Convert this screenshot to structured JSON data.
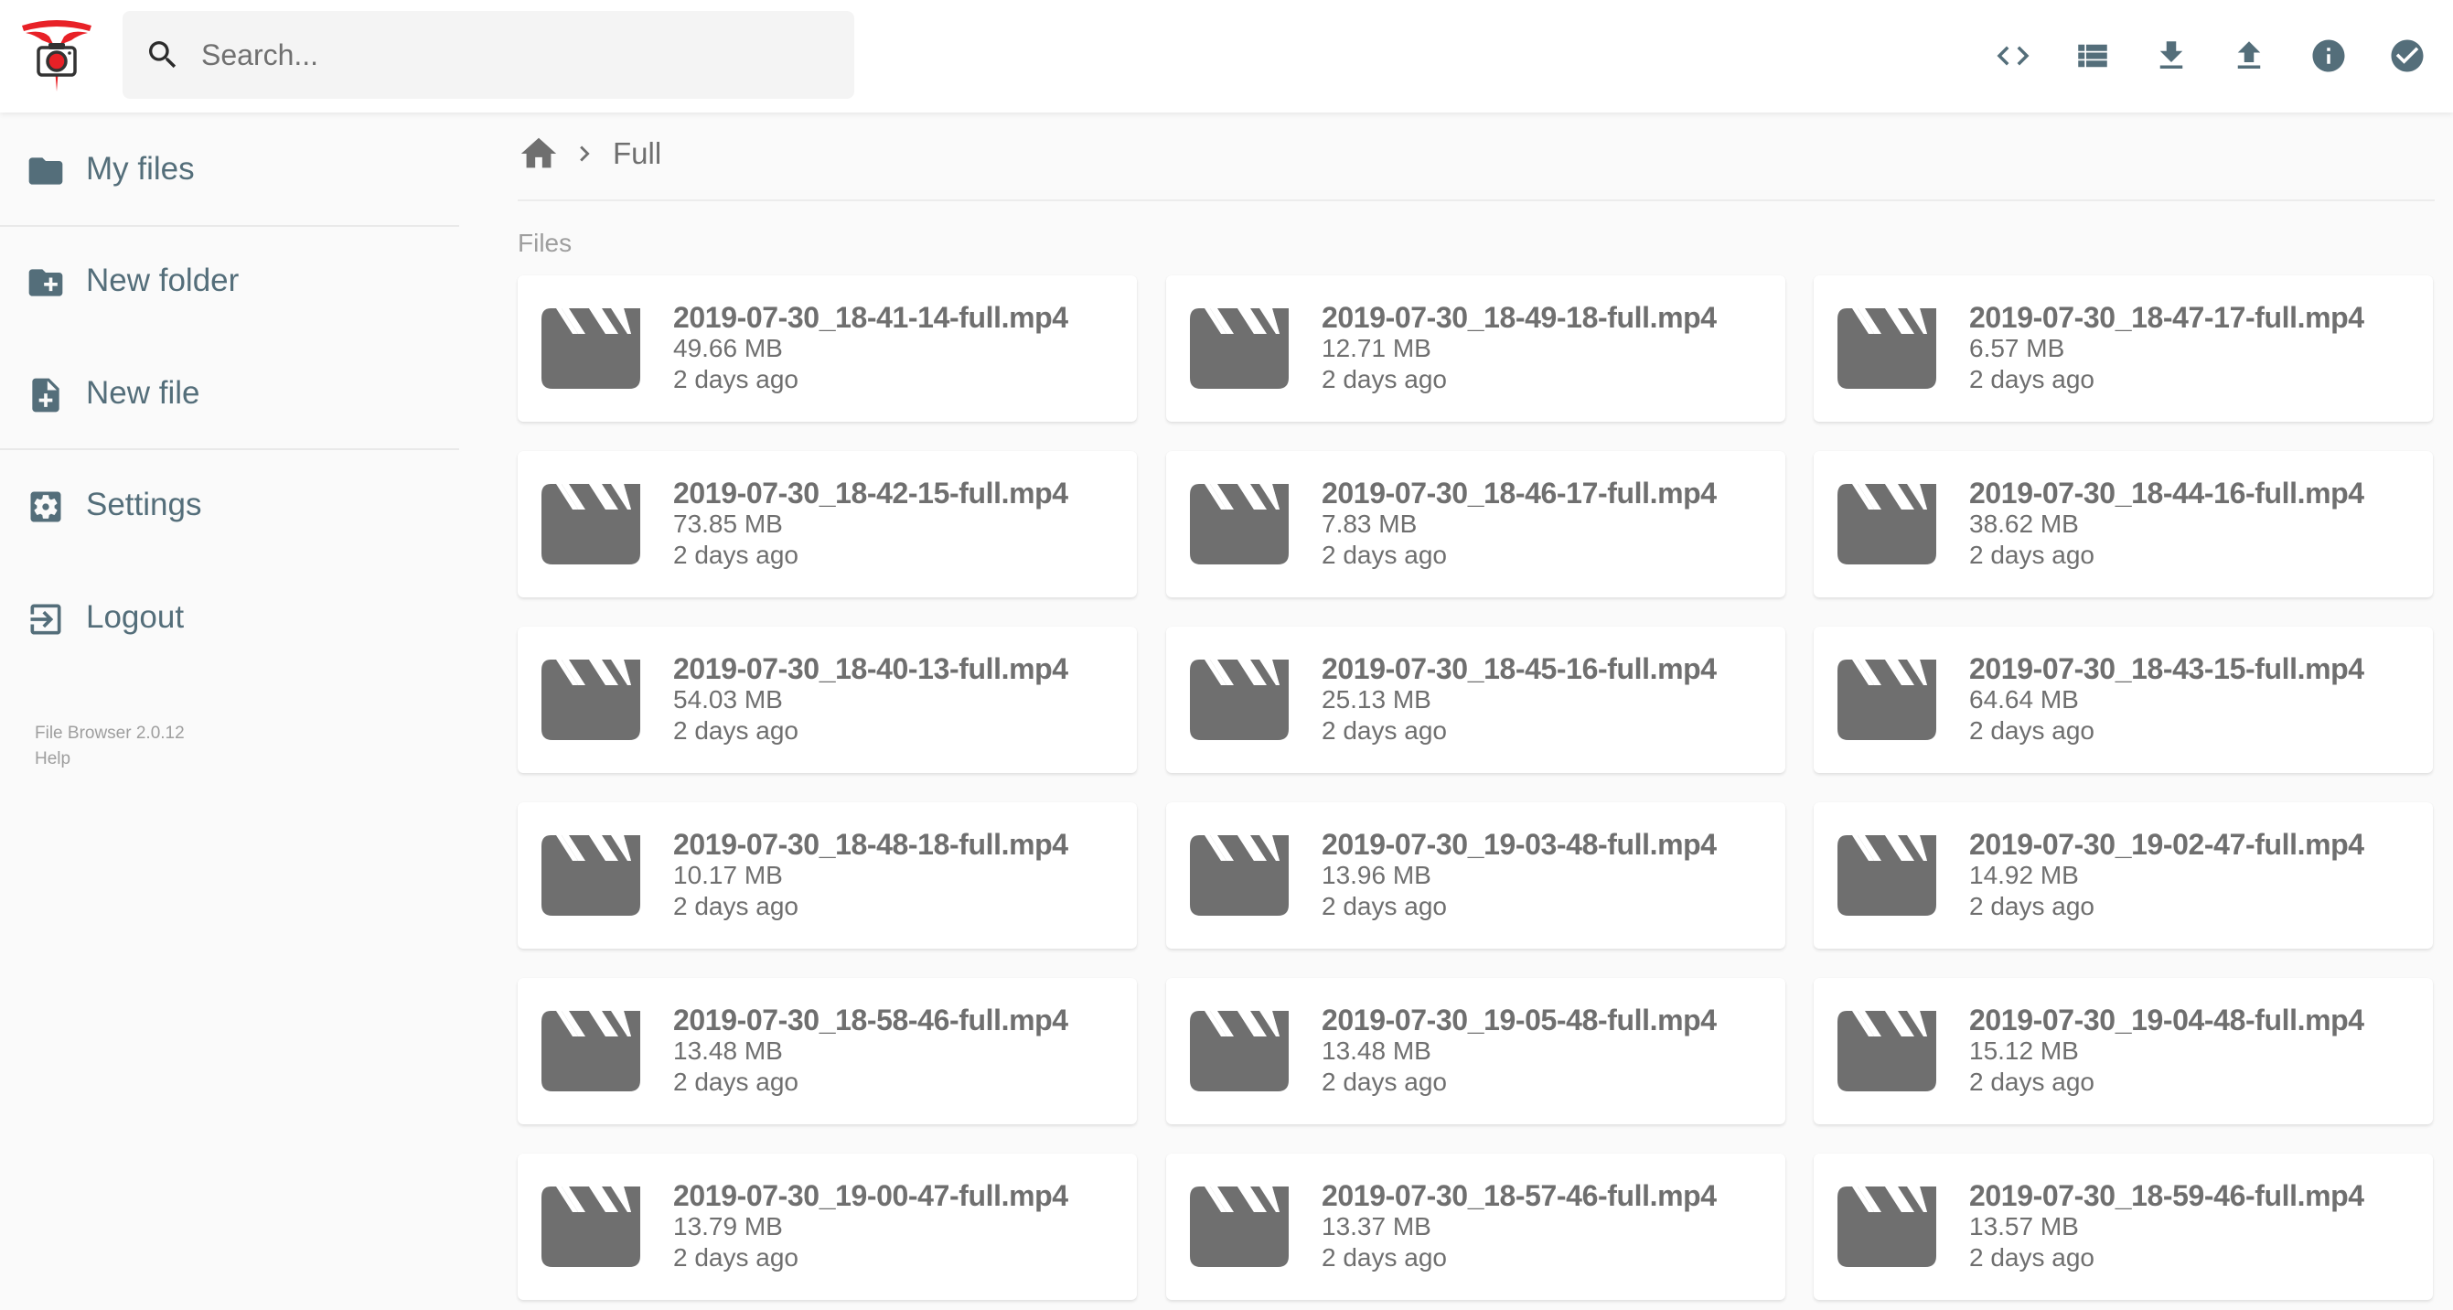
{
  "app": {
    "name": "File Browser",
    "version_text": "File Browser 2.0.12",
    "help_label": "Help"
  },
  "search": {
    "placeholder": "Search...",
    "value": ""
  },
  "header_actions": [
    {
      "name": "toggle-editor",
      "icon": "code-icon",
      "label": "Code view"
    },
    {
      "name": "switch-view",
      "icon": "view-list-icon",
      "label": "Switch view"
    },
    {
      "name": "download",
      "icon": "download-icon",
      "label": "Download"
    },
    {
      "name": "upload",
      "icon": "upload-icon",
      "label": "Upload"
    },
    {
      "name": "info",
      "icon": "info-icon",
      "label": "Info"
    },
    {
      "name": "select-multiple",
      "icon": "check-circle-icon",
      "label": "Select multiple"
    }
  ],
  "sidebar": {
    "items": [
      {
        "label": "My files",
        "icon": "folder-icon"
      },
      {
        "label": "New folder",
        "icon": "create-new-folder-icon"
      },
      {
        "label": "New file",
        "icon": "note-add-icon"
      },
      {
        "label": "Settings",
        "icon": "settings-applications-icon"
      },
      {
        "label": "Logout",
        "icon": "exit-to-app-icon"
      }
    ]
  },
  "breadcrumb": {
    "home_icon": "home-icon",
    "separator_icon": "chevron-right-icon",
    "current": "Full"
  },
  "section_label": "Files",
  "colors": {
    "accent": "#546E7A",
    "file_text": "#6F6F6F",
    "logo_red": "#E82127",
    "background": "#FAFAFA"
  },
  "files": [
    {
      "name": "2019-07-30_18-41-14-full.mp4",
      "size": "49.66 MB",
      "modified": "2 days ago",
      "icon": "movie-icon"
    },
    {
      "name": "2019-07-30_18-49-18-full.mp4",
      "size": "12.71 MB",
      "modified": "2 days ago",
      "icon": "movie-icon"
    },
    {
      "name": "2019-07-30_18-47-17-full.mp4",
      "size": "6.57 MB",
      "modified": "2 days ago",
      "icon": "movie-icon"
    },
    {
      "name": "2019-07-30_18-42-15-full.mp4",
      "size": "73.85 MB",
      "modified": "2 days ago",
      "icon": "movie-icon"
    },
    {
      "name": "2019-07-30_18-46-17-full.mp4",
      "size": "7.83 MB",
      "modified": "2 days ago",
      "icon": "movie-icon"
    },
    {
      "name": "2019-07-30_18-44-16-full.mp4",
      "size": "38.62 MB",
      "modified": "2 days ago",
      "icon": "movie-icon"
    },
    {
      "name": "2019-07-30_18-40-13-full.mp4",
      "size": "54.03 MB",
      "modified": "2 days ago",
      "icon": "movie-icon"
    },
    {
      "name": "2019-07-30_18-45-16-full.mp4",
      "size": "25.13 MB",
      "modified": "2 days ago",
      "icon": "movie-icon"
    },
    {
      "name": "2019-07-30_18-43-15-full.mp4",
      "size": "64.64 MB",
      "modified": "2 days ago",
      "icon": "movie-icon"
    },
    {
      "name": "2019-07-30_18-48-18-full.mp4",
      "size": "10.17 MB",
      "modified": "2 days ago",
      "icon": "movie-icon"
    },
    {
      "name": "2019-07-30_19-03-48-full.mp4",
      "size": "13.96 MB",
      "modified": "2 days ago",
      "icon": "movie-icon"
    },
    {
      "name": "2019-07-30_19-02-47-full.mp4",
      "size": "14.92 MB",
      "modified": "2 days ago",
      "icon": "movie-icon"
    },
    {
      "name": "2019-07-30_18-58-46-full.mp4",
      "size": "13.48 MB",
      "modified": "2 days ago",
      "icon": "movie-icon"
    },
    {
      "name": "2019-07-30_19-05-48-full.mp4",
      "size": "13.48 MB",
      "modified": "2 days ago",
      "icon": "movie-icon"
    },
    {
      "name": "2019-07-30_19-04-48-full.mp4",
      "size": "15.12 MB",
      "modified": "2 days ago",
      "icon": "movie-icon"
    },
    {
      "name": "2019-07-30_19-00-47-full.mp4",
      "size": "13.79 MB",
      "modified": "2 days ago",
      "icon": "movie-icon"
    },
    {
      "name": "2019-07-30_18-57-46-full.mp4",
      "size": "13.37 MB",
      "modified": "2 days ago",
      "icon": "movie-icon"
    },
    {
      "name": "2019-07-30_18-59-46-full.mp4",
      "size": "13.57 MB",
      "modified": "2 days ago",
      "icon": "movie-icon"
    }
  ]
}
